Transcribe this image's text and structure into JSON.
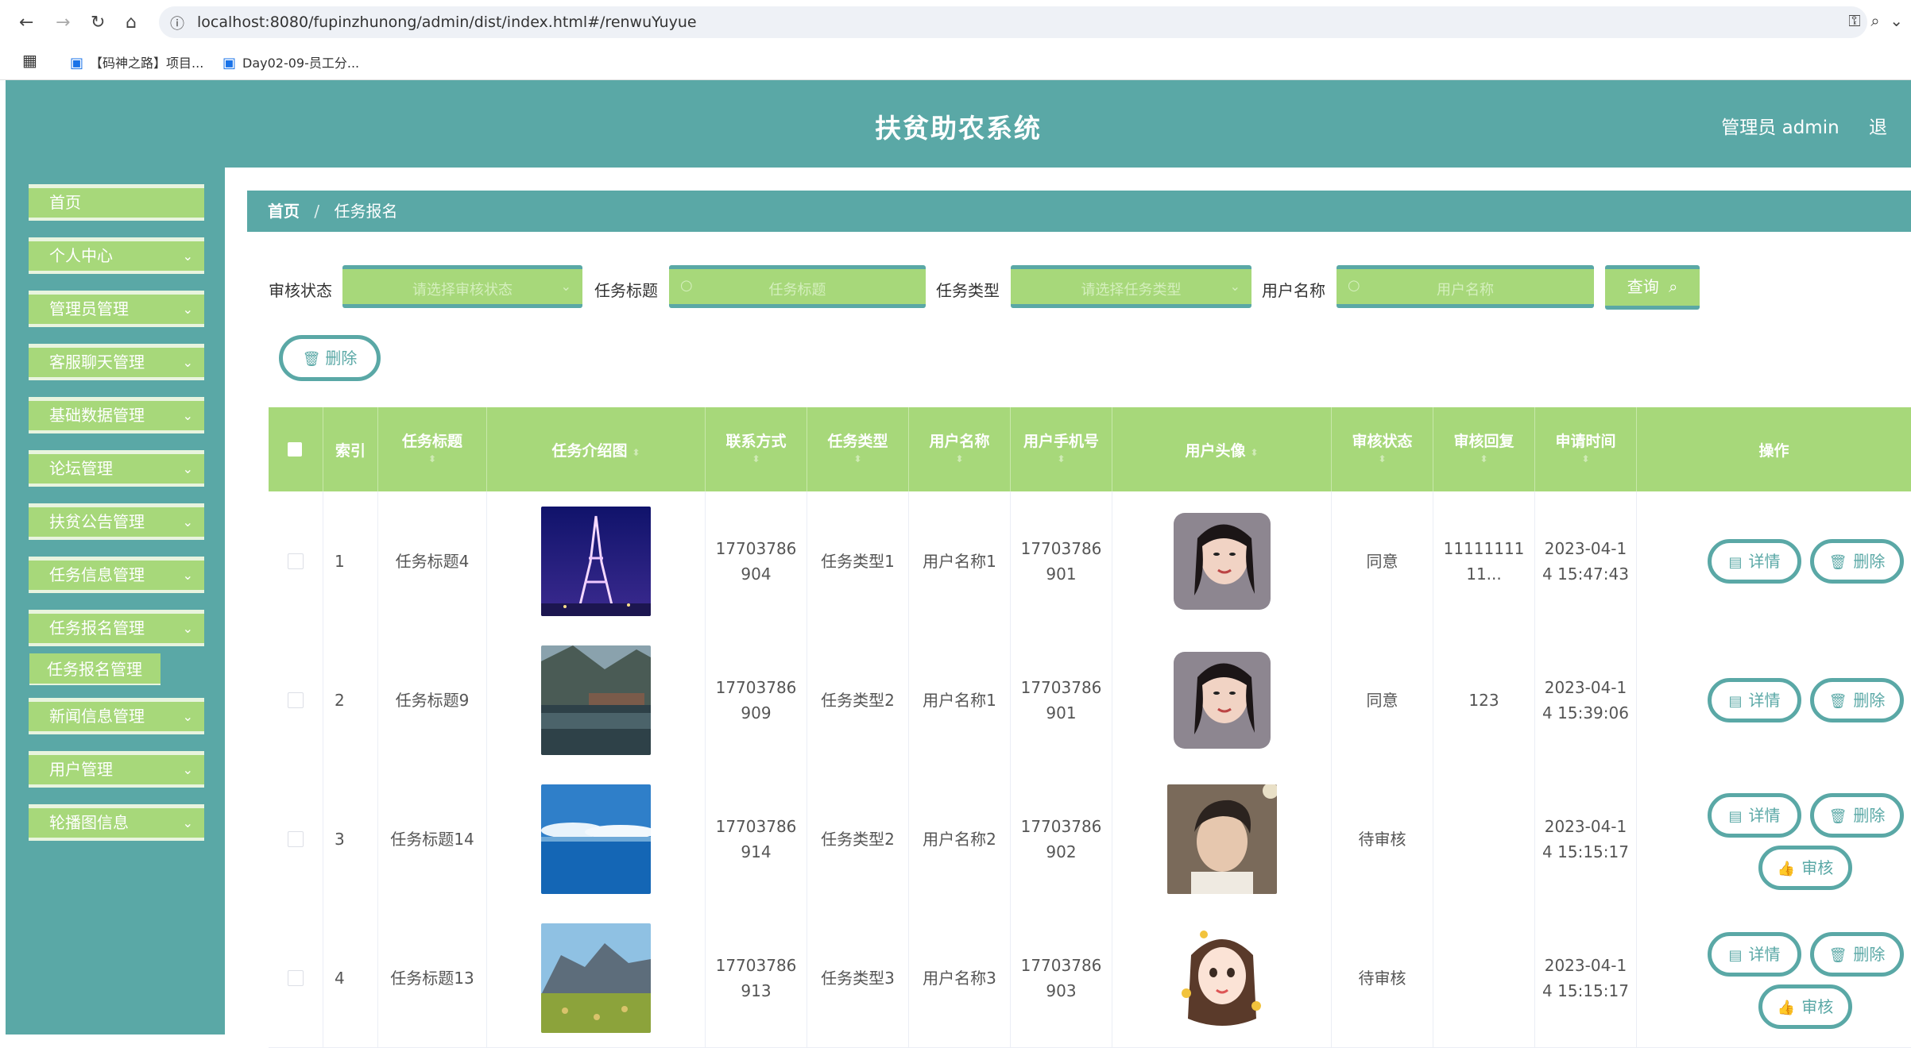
{
  "browser": {
    "url": "localhost:8080/fupinzhunong/admin/dist/index.html#/renwuYuyue",
    "bookmarks": [
      "【码神之路】项目...",
      "Day02-09-员工分..."
    ]
  },
  "header": {
    "title": "扶贫助农系统",
    "user": "管理员 admin",
    "extra": "退"
  },
  "sidebar": {
    "items": [
      {
        "label": "首页",
        "has_chevron": false
      },
      {
        "label": "个人中心",
        "has_chevron": true
      },
      {
        "label": "管理员管理",
        "has_chevron": true
      },
      {
        "label": "客服聊天管理",
        "has_chevron": true
      },
      {
        "label": "基础数据管理",
        "has_chevron": true
      },
      {
        "label": "论坛管理",
        "has_chevron": true
      },
      {
        "label": "扶贫公告管理",
        "has_chevron": true
      },
      {
        "label": "任务信息管理",
        "has_chevron": true
      },
      {
        "label": "任务报名管理",
        "has_chevron": true
      },
      {
        "label": "新闻信息管理",
        "has_chevron": true
      },
      {
        "label": "用户管理",
        "has_chevron": true
      },
      {
        "label": "轮播图信息",
        "has_chevron": true
      }
    ],
    "sub_item": "任务报名管理"
  },
  "breadcrumb": {
    "home": "首页",
    "current": "任务报名"
  },
  "search": {
    "audit_status_label": "审核状态",
    "audit_status_placeholder": "请选择审核状态",
    "task_title_label": "任务标题",
    "task_title_placeholder": "任务标题",
    "task_type_label": "任务类型",
    "task_type_placeholder": "请选择任务类型",
    "user_name_label": "用户名称",
    "user_name_placeholder": "用户名称",
    "query_button": "查询"
  },
  "toolbar": {
    "delete_button": "删除"
  },
  "table": {
    "headers": {
      "index": "索引",
      "task_title": "任务标题",
      "task_image": "任务介绍图",
      "contact": "联系方式",
      "task_type": "任务类型",
      "user_name": "用户名称",
      "user_phone": "用户手机号",
      "avatar": "用户头像",
      "audit_status": "审核状态",
      "audit_reply": "审核回复",
      "apply_time": "申请时间",
      "actions": "操作"
    },
    "rows": [
      {
        "index": "1",
        "task_title": "任务标题4",
        "contact_a": "17703786",
        "contact_b": "904",
        "task_type": "任务类型1",
        "user_name": "用户名称1",
        "phone_a": "17703786",
        "phone_b": "901",
        "audit_status": "同意",
        "reply_a": "11111111",
        "reply_b": "11...",
        "time_a": "2023-04-1",
        "time_b": "4 15:47:43",
        "task_image": "eiffel-tower-night",
        "avatar": "woman-with-pillow",
        "show_audit": false
      },
      {
        "index": "2",
        "task_title": "任务标题9",
        "contact_a": "17703786",
        "contact_b": "909",
        "task_type": "任务类型2",
        "user_name": "用户名称1",
        "phone_a": "17703786",
        "phone_b": "901",
        "audit_status": "同意",
        "reply_a": "123",
        "reply_b": "",
        "time_a": "2023-04-1",
        "time_b": "4 15:39:06",
        "task_image": "lakeside-village",
        "avatar": "woman-with-pillow",
        "show_audit": false
      },
      {
        "index": "3",
        "task_title": "任务标题14",
        "contact_a": "17703786",
        "contact_b": "914",
        "task_type": "任务类型2",
        "user_name": "用户名称2",
        "phone_a": "17703786",
        "phone_b": "902",
        "audit_status": "待审核",
        "reply_a": "",
        "reply_b": "",
        "time_a": "2023-04-1",
        "time_b": "4 15:15:17",
        "task_image": "ocean-sky",
        "avatar": "young-man",
        "show_audit": true
      },
      {
        "index": "4",
        "task_title": "任务标题13",
        "contact_a": "17703786",
        "contact_b": "913",
        "task_type": "任务类型3",
        "user_name": "用户名称3",
        "phone_a": "17703786",
        "phone_b": "903",
        "audit_status": "待审核",
        "reply_a": "",
        "reply_b": "",
        "time_a": "2023-04-1",
        "time_b": "4 15:15:17",
        "task_image": "mountain-meadow",
        "avatar": "cartoon-girl",
        "show_audit": true
      }
    ],
    "action_labels": {
      "detail": "详情",
      "delete": "删除",
      "audit": "审核"
    }
  },
  "colors": {
    "teal": "#5aa8a6",
    "green": "#a7d87a"
  }
}
